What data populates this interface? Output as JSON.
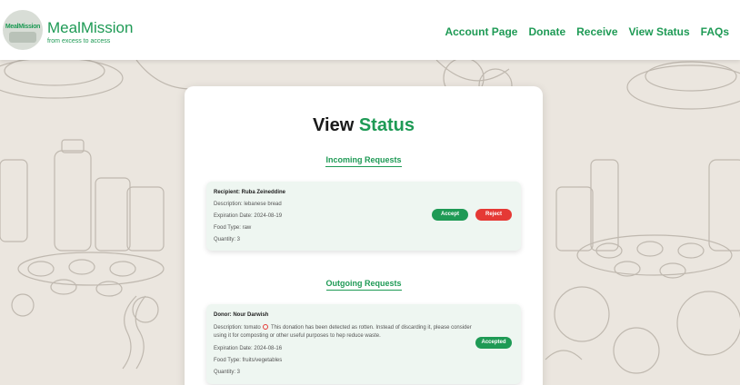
{
  "brand": {
    "name": "MealMission",
    "tagline": "from excess to access",
    "logo_text": "MealMission"
  },
  "nav": [
    {
      "label": "Account Page"
    },
    {
      "label": "Donate"
    },
    {
      "label": "Receive"
    },
    {
      "label": "View Status"
    },
    {
      "label": "FAQs"
    }
  ],
  "page": {
    "title_prefix": "View",
    "title_accent": "Status"
  },
  "incoming": {
    "heading": "Incoming Requests",
    "request": {
      "recipient": "Recipient: Ruba Zeineddine",
      "description": "Description: lebanese bread",
      "expiration": "Expiration Date: 2024-08-19",
      "food_type": "Food Type: raw",
      "quantity": "Quantity: 3",
      "accept_label": "Accept",
      "reject_label": "Reject"
    }
  },
  "outgoing": {
    "heading": "Outgoing Requests",
    "request": {
      "donor": "Donor: Nour Darwish",
      "description_prefix": "Description: tomato",
      "description_warning": "This donation has been detected as rotten. Instead of discarding it, please consider using it for composting or other useful purposes to hep reduce waste.",
      "expiration": "Expiration Date: 2024-08-16",
      "food_type": "Food Type: fruits/vegetables",
      "quantity": "Quantity: 3",
      "status_label": "Accepted"
    }
  },
  "colors": {
    "brand": "#1e9a55",
    "reject": "#e53935",
    "card_bg": "#eef6f1"
  },
  "icons": {
    "rotten_warning": "prohibited-icon"
  }
}
